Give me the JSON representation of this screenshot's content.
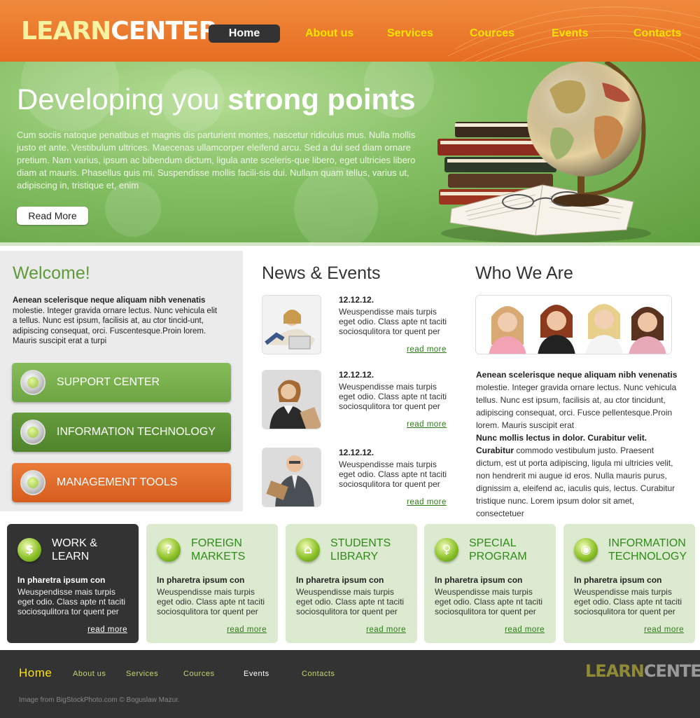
{
  "logo": {
    "part1": "LEARN",
    "part2": "CENTER"
  },
  "nav": [
    "Home",
    "About us",
    "Services",
    "Cources",
    "Events",
    "Contacts"
  ],
  "hero": {
    "title_light": "Developing you",
    "title_bold": "strong points",
    "text": "Cum sociis natoque penatibus et magnis dis parturient montes, nascetur ridiculus mus. Nulla mollis justo et ante. Vestibulum ultrices. Maecenas ullamcorper eleifend arcu. Sed a dui sed diam ornare pretium. Nam varius, ipsum ac bibendum dictum, ligula ante sceleris-que libero, eget ultricies libero diam at mauris. Phasellus quis mi. Suspendisse mollis facili-sis dui. Nullam quam tellus, varius ut, adipiscing in, tristique et, enim",
    "button": "Read More"
  },
  "welcome": {
    "title": "Welcome!",
    "lead_bold": "Aenean scelerisque neque aliquam nibh venenatis",
    "lead_text": "molestie. Integer gravida ornare lectus. Nunc vehicula elit a tellus. Nunc est ipsum, facilisis at, au ctor tincid-unt, adipiscing consequat, orci. Fuscentesque.Proin lorem. Mauris suscipit erat a turpi",
    "buttons": [
      {
        "label": "SUPPORT CENTER",
        "color": "#7ab24e"
      },
      {
        "label": "INFORMATION TECHNOLOGY",
        "color": "#5a8e35"
      },
      {
        "label": "MANAGEMENT TOOLS",
        "color": "#e0692a"
      }
    ]
  },
  "news": {
    "title": "News & Events",
    "items": [
      {
        "date": "12.12.12.",
        "text": "Weuspendisse mais turpis eget odio. Class apte nt taciti sociosqulitora tor quent per",
        "more": "read more"
      },
      {
        "date": "12.12.12.",
        "text": "Weuspendisse mais turpis eget odio. Class apte nt taciti sociosqulitora tor quent per",
        "more": "read more"
      },
      {
        "date": "12.12.12.",
        "text": "Weuspendisse mais turpis eget odio. Class apte nt taciti sociosqulitora tor quent per",
        "more": "read more"
      }
    ]
  },
  "who": {
    "title": "Who We Are",
    "p1_bold": "Aenean scelerisque neque aliquam nibh venenatis",
    "p1_text": "molestie. Integer gravida ornare lectus. Nunc vehicula tellus. Nunc est ipsum, facilisis at, au ctor tincidunt, adipiscing consequat, orci. Fusce pellentesque.Proin lorem. Mauris suscipit erat",
    "p2_bold": "Nunc mollis lectus in dolor. Curabitur velit. Curabitur",
    "p2_text": "commodo vestibulum justo. Praesent dictum, est ut porta adipiscing, ligula mi ultricies velit, non hendrerit mi augue id eros. Nulla mauris purus, dignissim a, eleifend ac, iaculis quis, lectus. Curabitur tristique nunc. Lorem ipsum dolor sit amet, consectetuer"
  },
  "features": [
    {
      "title": "WORK & LEARN",
      "icon": "$",
      "sub": "In pharetra ipsum con",
      "text": "Weuspendisse mais turpis eget odio. Class apte nt taciti sociosqulitora tor quent per",
      "more": "read more"
    },
    {
      "title": "FOREIGN MARKETS",
      "icon": "?",
      "sub": "In pharetra ipsum con",
      "text": "Weuspendisse mais turpis eget odio. Class apte nt taciti sociosqulitora tor quent per",
      "more": "read more"
    },
    {
      "title": "STUDENTS LIBRARY",
      "icon": "⌂",
      "sub": "In pharetra ipsum con",
      "text": "Weuspendisse mais turpis eget odio. Class apte nt taciti sociosqulitora tor quent per",
      "more": "read more"
    },
    {
      "title": "SPECIAL PROGRAM",
      "icon": "♀",
      "sub": "In pharetra ipsum con",
      "text": "Weuspendisse mais turpis eget odio. Class apte nt taciti sociosqulitora tor quent per",
      "more": "read more"
    },
    {
      "title": "INFORMATION TECHNOLOGY",
      "icon": "◉",
      "sub": "In pharetra ipsum con",
      "text": "Weuspendisse mais turpis eget odio. Class apte nt taciti sociosqulitora tor quent per",
      "more": "read more"
    }
  ],
  "footer": {
    "nav": [
      "Home",
      "About us",
      "Services",
      "Cources",
      "Events",
      "Contacts"
    ],
    "logo_part1": "LEARN",
    "logo_part2": "CENTER",
    "credit": "Image from BigStockPhoto.com © Boguslaw Mazur."
  },
  "colors": {
    "header": "#e66d22",
    "nav_active_bg": "#333333",
    "nav_link": "#ffe400",
    "accent_green": "#5f9a3a",
    "feature_bg": "#dcebcf",
    "footer_bg": "#333333"
  }
}
